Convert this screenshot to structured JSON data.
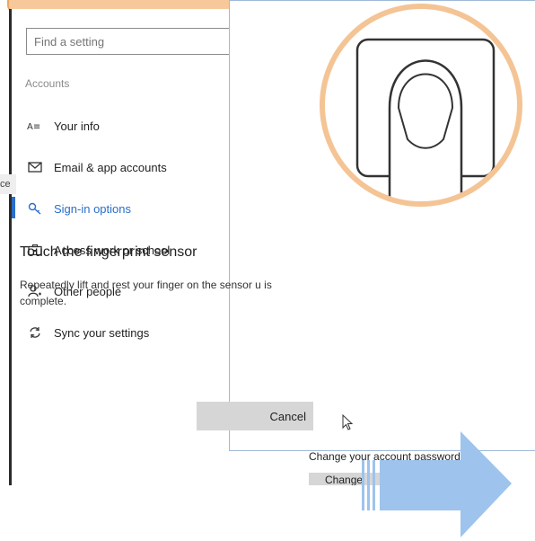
{
  "search": {
    "placeholder": "Find a setting"
  },
  "sidebar": {
    "section_label": "Accounts",
    "items": [
      {
        "label": "Your info",
        "icon": "person-card-icon"
      },
      {
        "label": "Email & app accounts",
        "icon": "mail-icon"
      },
      {
        "label": "Sign-in options",
        "icon": "key-icon",
        "active": true
      },
      {
        "label": "Access work or school",
        "icon": "briefcase-icon"
      },
      {
        "label": "Other people",
        "icon": "person-add-icon"
      },
      {
        "label": "Sync your settings",
        "icon": "sync-icon"
      }
    ],
    "ghost_tab": "ce"
  },
  "dialog": {
    "title": "Touch the fingerprint sensor",
    "description": "Repeatedly lift and rest your finger on the sensor u is complete.",
    "cancel_label": "Cancel"
  },
  "background": {
    "change_password_text": "Change your account password",
    "change_button": "Change"
  },
  "colors": {
    "accent": "#2a6ec9",
    "highlight_orange": "#f4c495",
    "arrow_blue": "#9ec3ec"
  }
}
